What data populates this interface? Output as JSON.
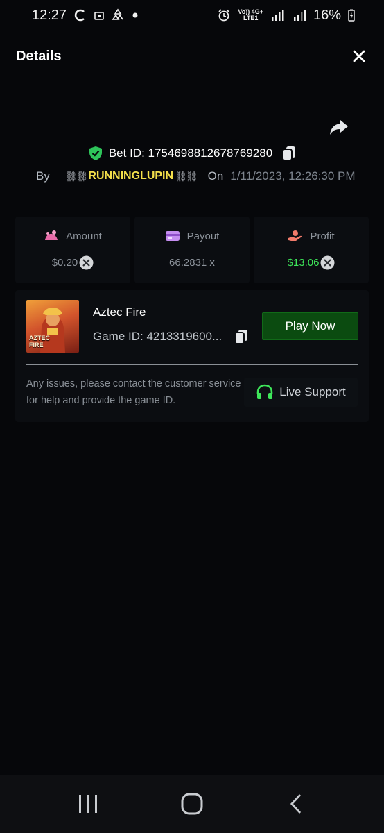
{
  "status_bar": {
    "time": "12:27",
    "network_top": "Vo)) 4G+",
    "network_bottom": "LTE1",
    "battery": "16%"
  },
  "header": {
    "title": "Details"
  },
  "bet": {
    "id_label": "Bet ID: 1754698812678769280",
    "by_label": "By",
    "username": "RUNNINGLUPIN",
    "on_label": "On",
    "date": "1/11/2023, 12:26:30 PM"
  },
  "stats": {
    "amount_label": "Amount",
    "amount_value": "$0.20",
    "payout_label": "Payout",
    "payout_value": "66.2831 x",
    "profit_label": "Profit",
    "profit_value": "$13.06"
  },
  "game": {
    "name": "Aztec Fire",
    "thumb_line1": "AZTEC",
    "thumb_line2": "FIRE",
    "id_label": "Game ID: 4213319600...",
    "play_label": "Play Now",
    "support_text": "Any issues, please contact the customer service for help and provide the game ID.",
    "live_support_label": "Live Support"
  },
  "colors": {
    "accent_green": "#3ee65a",
    "play_bg": "#0b4b10",
    "username": "#f4e04b",
    "background": "#06070a"
  },
  "icons": [
    "shield-check-icon",
    "copy-icon",
    "share-icon",
    "close-icon",
    "amount-icon",
    "payout-card-icon",
    "profit-hand-icon",
    "x-circle-icon",
    "headset-icon",
    "recents-icon",
    "home-icon",
    "back-icon"
  ]
}
